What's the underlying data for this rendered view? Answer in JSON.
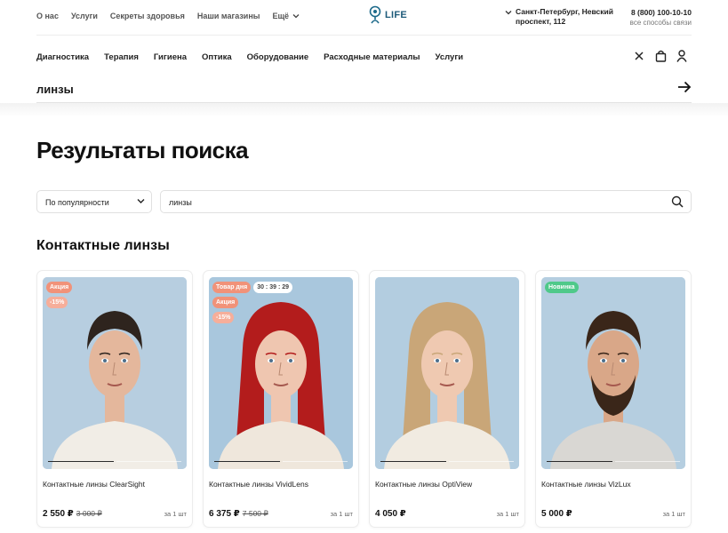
{
  "header": {
    "top_links": [
      "О нас",
      "Услуги",
      "Секреты здоровья",
      "Наши магазины"
    ],
    "more_label": "Ещё",
    "logo_text": "LIFE",
    "address": "Санкт-Петербург, Невский проспект, 112",
    "phone": "8 (800) 100-10-10",
    "contact_label": "все способы связи"
  },
  "nav": {
    "categories": [
      "Диагностика",
      "Терапия",
      "Гигиена",
      "Оптика",
      "Оборудование",
      "Расходные материалы",
      "Услуги"
    ]
  },
  "search": {
    "query": "линзы"
  },
  "page": {
    "title": "Результаты поиска",
    "sort_value": "По популярности",
    "filter_value": "линзы",
    "section_title": "Контактные линзы"
  },
  "products": [
    {
      "name": "Контактные линзы ClearSight",
      "price": "2 550 ₽",
      "old_price": "3 000 ₽",
      "unit": "за 1 шт",
      "badges": [
        "Акция",
        "-15%"
      ],
      "day_badge": "",
      "timer": "",
      "colors": {
        "bg": "#b7cee0",
        "hair": "#2e241e",
        "skin": "#e4b79c",
        "shirt": "#f1ede6"
      },
      "hair_style": "short",
      "beard": false
    },
    {
      "name": "Контактные линзы VividLens",
      "price": "6 375 ₽",
      "old_price": "7 500 ₽",
      "unit": "за 1 шт",
      "badges": [
        "Акция",
        "-15%"
      ],
      "day_badge": "Товар дня",
      "timer": "30 : 39 : 29",
      "colors": {
        "bg": "#a9c7dd",
        "hair": "#b31c1c",
        "skin": "#efc6b0",
        "shirt": "#efe7dc"
      },
      "hair_style": "long",
      "beard": false
    },
    {
      "name": "Контактные линзы OptiView",
      "price": "4 050 ₽",
      "old_price": "",
      "unit": "за 1 шт",
      "badges": [],
      "day_badge": "",
      "timer": "",
      "colors": {
        "bg": "#b3cde0",
        "hair": "#c9a678",
        "skin": "#efc9b1",
        "shirt": "#f1ebe1"
      },
      "hair_style": "long",
      "beard": false
    },
    {
      "name": "Контактные линзы VizLux",
      "price": "5 000 ₽",
      "old_price": "",
      "unit": "за 1 шт",
      "badges": [
        "Новинка"
      ],
      "day_badge": "",
      "timer": "",
      "colors": {
        "bg": "#b5cee0",
        "hair": "#3a2619",
        "skin": "#d9a788",
        "shirt": "#d9d7d3"
      },
      "hair_style": "short",
      "beard": true
    }
  ]
}
